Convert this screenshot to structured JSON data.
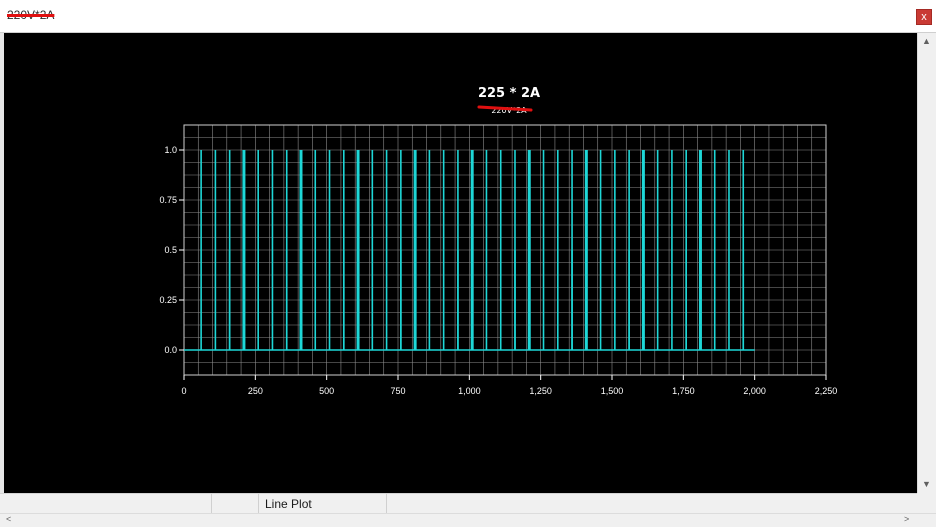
{
  "window": {
    "title": "220V*2A",
    "close_label": "x",
    "accent": "#c93a34"
  },
  "statusbar": {
    "label": "Line Plot"
  },
  "chart_data": {
    "type": "line",
    "title": "225 * 2A",
    "subtitle": "220V*2A",
    "xlabel": "",
    "ylabel": "",
    "xlim": [
      0,
      2250
    ],
    "ylim": [
      -0.125,
      1.125
    ],
    "xticks": [
      0,
      250,
      500,
      750,
      1000,
      1250,
      1500,
      1750,
      2000,
      2250
    ],
    "xtick_labels": [
      "0",
      "250",
      "500",
      "750",
      "1,000",
      "1,250",
      "1,500",
      "1,750",
      "2,000",
      "2,250"
    ],
    "yticks": [
      0.0,
      0.25,
      0.5,
      0.75,
      1.0
    ],
    "ytick_labels": [
      "0.0",
      "0.25",
      "0.5",
      "0.75",
      "1.0"
    ],
    "grid": true,
    "colors": {
      "line": "#1ed7d7",
      "grid": "#8c8c8c",
      "background": "#000000"
    },
    "baseline": {
      "x_start": 0,
      "x_end": 2000,
      "value": 0
    },
    "pulses": [
      {
        "x": 60,
        "y": 1.0
      },
      {
        "x": 110,
        "y": 1.0
      },
      {
        "x": 160,
        "y": 1.0
      },
      {
        "x": 210,
        "y": 1.0
      },
      {
        "x": 260,
        "y": 1.0
      },
      {
        "x": 310,
        "y": 1.0
      },
      {
        "x": 360,
        "y": 1.0
      },
      {
        "x": 410,
        "y": 1.0
      },
      {
        "x": 460,
        "y": 1.0
      },
      {
        "x": 510,
        "y": 1.0
      },
      {
        "x": 560,
        "y": 1.0
      },
      {
        "x": 610,
        "y": 1.0
      },
      {
        "x": 660,
        "y": 1.0
      },
      {
        "x": 710,
        "y": 1.0
      },
      {
        "x": 760,
        "y": 1.0
      },
      {
        "x": 810,
        "y": 1.0
      },
      {
        "x": 860,
        "y": 1.0
      },
      {
        "x": 910,
        "y": 1.0
      },
      {
        "x": 960,
        "y": 1.0
      },
      {
        "x": 1010,
        "y": 1.0
      },
      {
        "x": 1060,
        "y": 1.0
      },
      {
        "x": 1110,
        "y": 1.0
      },
      {
        "x": 1160,
        "y": 1.0
      },
      {
        "x": 1210,
        "y": 1.0
      },
      {
        "x": 1260,
        "y": 1.0
      },
      {
        "x": 1310,
        "y": 1.0
      },
      {
        "x": 1360,
        "y": 1.0
      },
      {
        "x": 1410,
        "y": 1.0
      },
      {
        "x": 1460,
        "y": 1.0
      },
      {
        "x": 1510,
        "y": 1.0
      },
      {
        "x": 1560,
        "y": 1.0
      },
      {
        "x": 1610,
        "y": 1.0
      },
      {
        "x": 1660,
        "y": 1.0
      },
      {
        "x": 1710,
        "y": 1.0
      },
      {
        "x": 1760,
        "y": 1.0
      },
      {
        "x": 1810,
        "y": 1.0
      },
      {
        "x": 1860,
        "y": 1.0
      },
      {
        "x": 1910,
        "y": 1.0
      },
      {
        "x": 1960,
        "y": 1.0
      },
      {
        "x": 160,
        "y": 0.5
      },
      {
        "x": 360,
        "y": 0.5
      },
      {
        "x": 560,
        "y": 0.5
      },
      {
        "x": 760,
        "y": 0.5
      },
      {
        "x": 960,
        "y": 0.5
      },
      {
        "x": 1160,
        "y": 0.5
      },
      {
        "x": 1360,
        "y": 0.5
      },
      {
        "x": 1560,
        "y": 0.5
      },
      {
        "x": 1760,
        "y": 0.5
      },
      {
        "x": 1960,
        "y": 0.5
      }
    ],
    "bold_pulses": [
      210,
      410,
      610,
      810,
      1010,
      1210,
      1410,
      1610,
      1810
    ]
  }
}
